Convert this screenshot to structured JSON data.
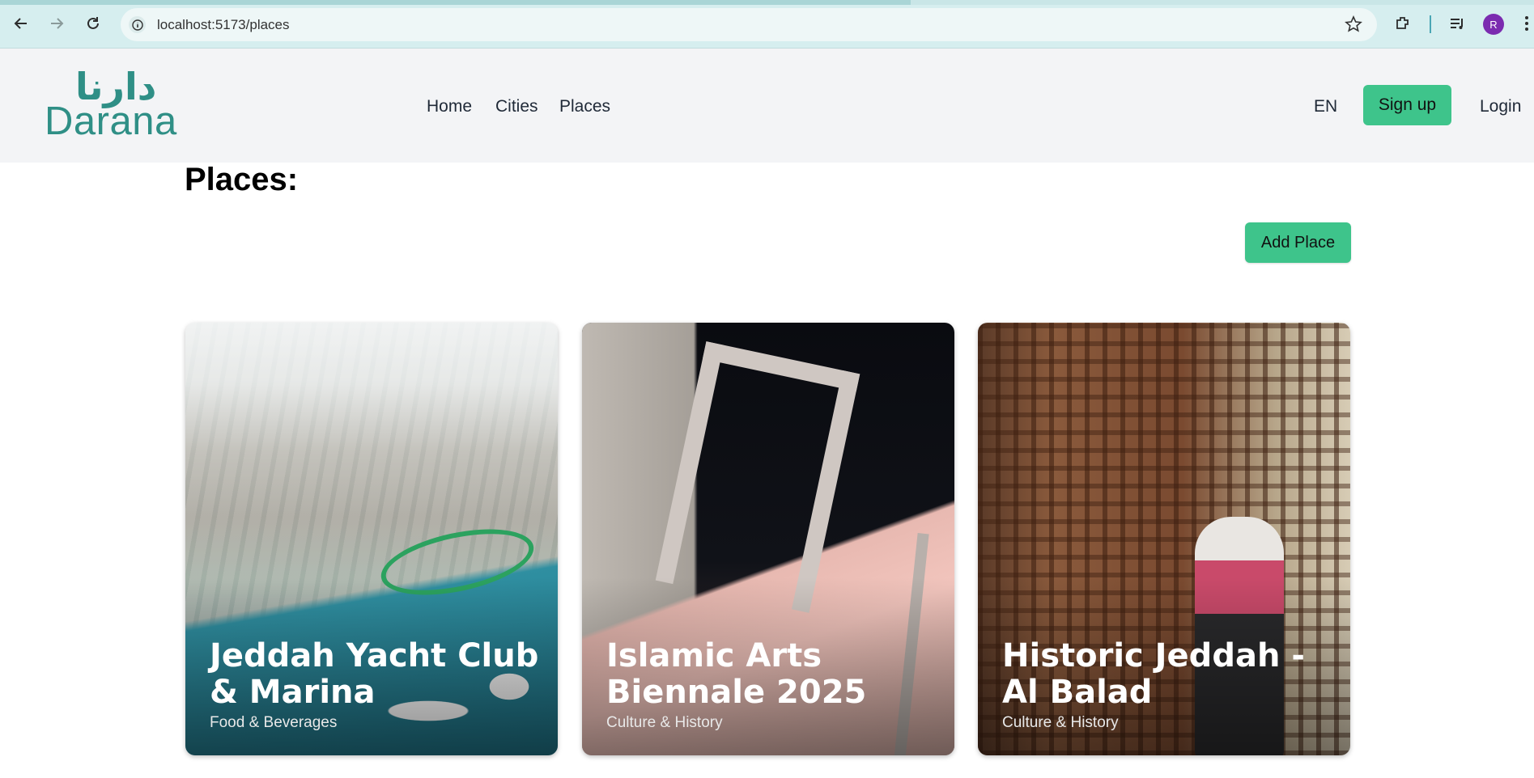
{
  "browser": {
    "url": "localhost:5173/places",
    "avatar_initial": "R"
  },
  "header": {
    "logo_arabic": "دارنا",
    "logo_text": "Darana",
    "nav": [
      "Home",
      "Cities",
      "Places"
    ],
    "language": "EN",
    "signup_label": "Sign up",
    "login_label": "Login"
  },
  "main": {
    "title": "Places:",
    "add_button_label": "Add Place",
    "cards": [
      {
        "title": "Jeddah Yacht Club & Marina",
        "category": "Food & Beverages"
      },
      {
        "title": "Islamic Arts Biennale 2025",
        "category": "Culture & History"
      },
      {
        "title": "Historic Jeddah - Al Balad",
        "category": "Culture & History"
      }
    ]
  },
  "colors": {
    "accent_green": "#3ec48b",
    "logo_teal": "#2f8f86",
    "header_bg": "#f3f4f6",
    "chrome_bg": "#d6eeef"
  },
  "icons": [
    "back-arrow-icon",
    "forward-arrow-icon",
    "reload-icon",
    "site-info-icon",
    "bookmark-star-icon",
    "extensions-icon",
    "media-controls-icon",
    "profile-avatar-icon",
    "more-menu-icon"
  ]
}
